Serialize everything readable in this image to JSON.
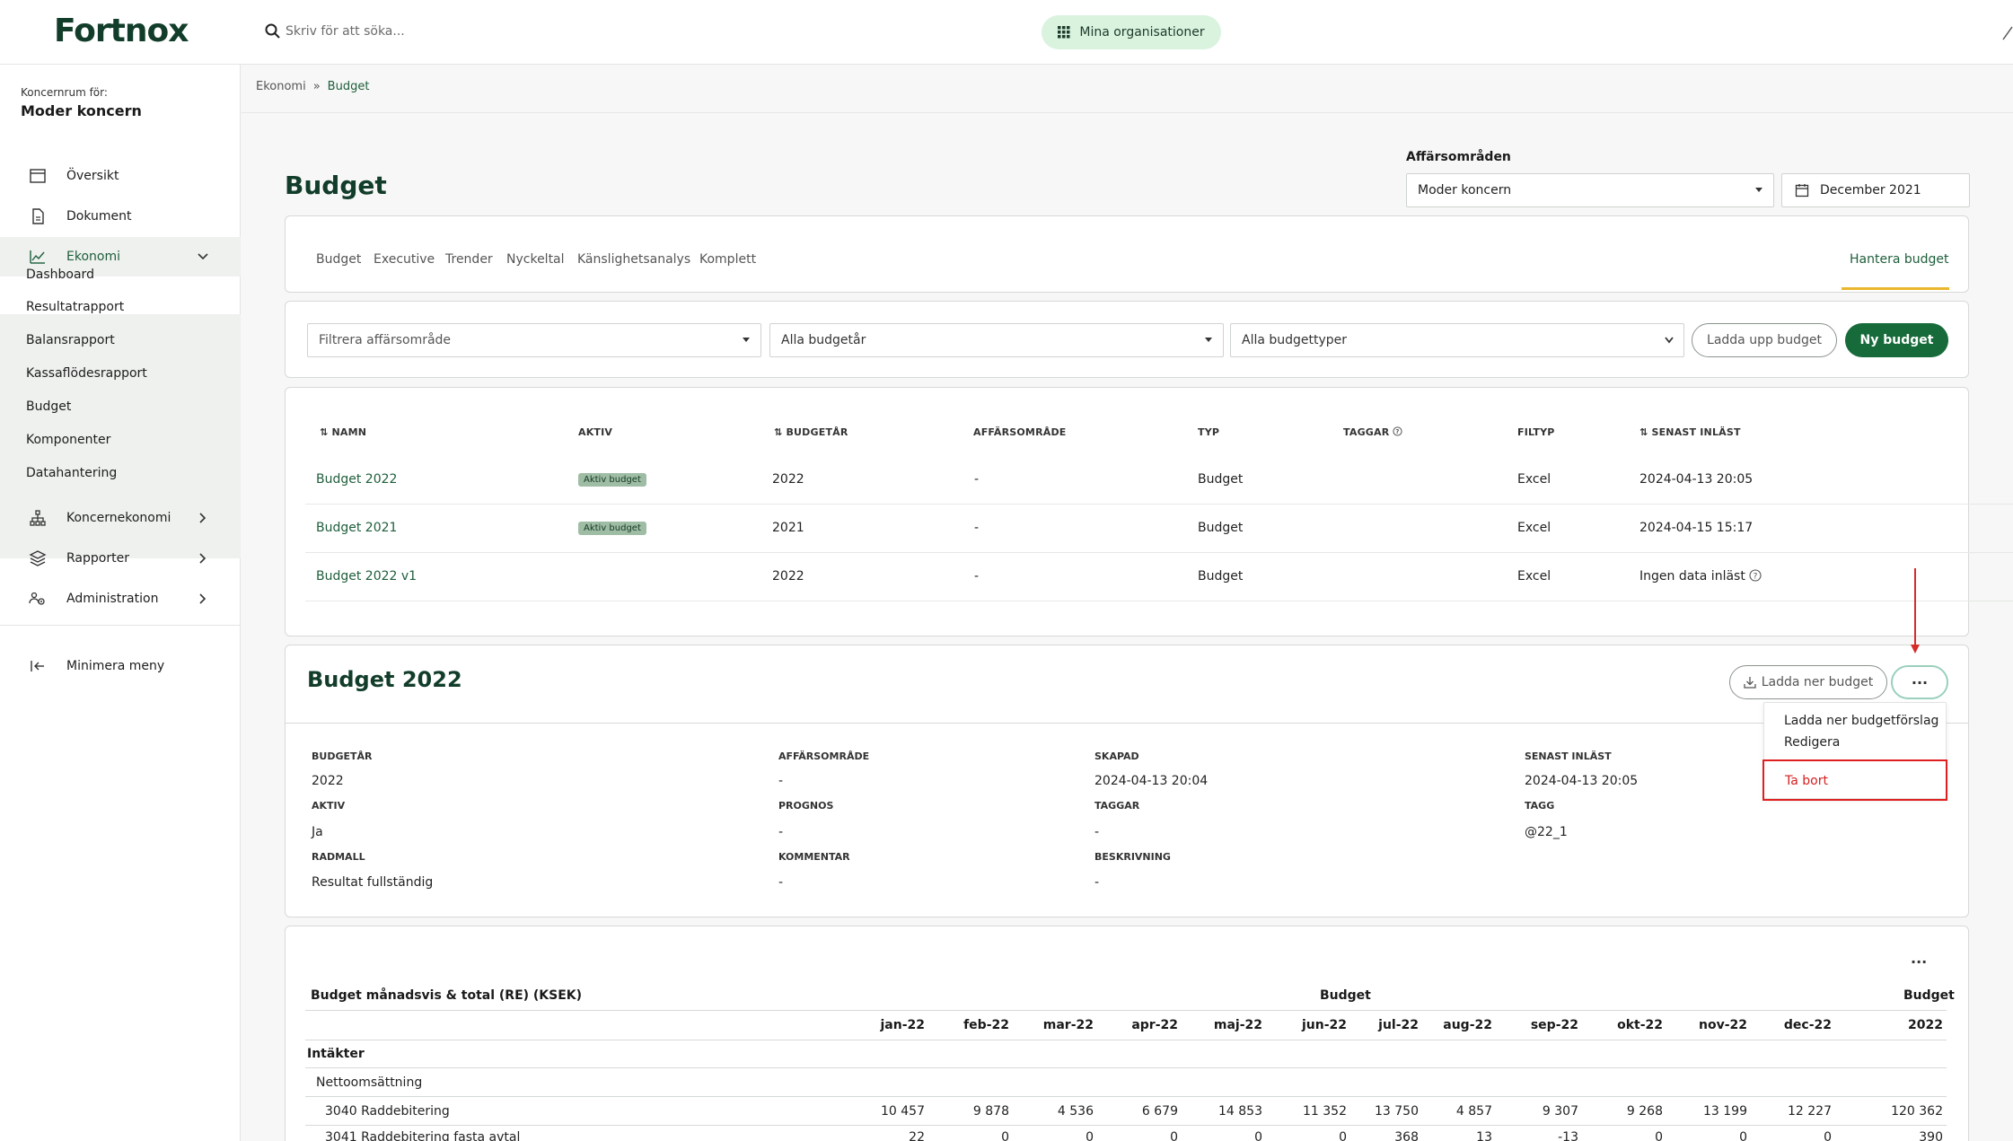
{
  "app": {
    "logo": "Fortnox"
  },
  "topbar": {
    "search_placeholder": "Skriv för att söka...",
    "org_button": "Mina organisationer"
  },
  "sidebar": {
    "org_label": "Koncernrum för:",
    "org_name": "Moder koncern",
    "items": [
      {
        "label": "Översikt",
        "icon": "calendar-icon"
      },
      {
        "label": "Dokument",
        "icon": "document-icon"
      },
      {
        "label": "Ekonomi",
        "icon": "chart-line-icon"
      },
      {
        "label": "Koncernekonomi",
        "icon": "org-tree-icon"
      },
      {
        "label": "Rapporter",
        "icon": "layers-icon"
      },
      {
        "label": "Administration",
        "icon": "users-gear-icon"
      }
    ],
    "sub_items": [
      "Dashboard",
      "Resultatrapport",
      "Balansrapport",
      "Kassaflödesrapport",
      "Budget",
      "Komponenter",
      "Datahantering"
    ],
    "minimize": "Minimera meny"
  },
  "breadcrumb": {
    "parent": "Ekonomi",
    "sep": "»",
    "current": "Budget"
  },
  "page": {
    "title": "Budget",
    "af_label": "Affärsområden",
    "af_value": "Moder koncern",
    "date_value": "December 2021"
  },
  "tabs": [
    "Budget",
    "Executive",
    "Trender",
    "Nyckeltal",
    "Känslighetsanalys",
    "Komplett"
  ],
  "tab_right": "Hantera budget",
  "filters": {
    "area_placeholder": "Filtrera affärsområde",
    "years": "Alla budgetår",
    "types": "Alla budgettyper",
    "upload": "Ladda upp budget",
    "new": "Ny budget"
  },
  "list": {
    "headers": [
      "NAMN",
      "AKTIV",
      "BUDGETÅR",
      "AFFÄRSOMRÅDE",
      "TYP",
      "TAGGAR",
      "FILTYP",
      "SENAST INLÄST"
    ],
    "rows": [
      {
        "name": "Budget 2022",
        "active": "Aktiv budget",
        "year": "2022",
        "area": "-",
        "type": "Budget",
        "filetype": "Excel",
        "loaded": "2024-04-13 20:05"
      },
      {
        "name": "Budget 2021",
        "active": "Aktiv budget",
        "year": "2021",
        "area": "-",
        "type": "Budget",
        "filetype": "Excel",
        "loaded": "2024-04-15 15:17"
      },
      {
        "name": "Budget 2022 v1",
        "active": "",
        "year": "2022",
        "area": "-",
        "type": "Budget",
        "filetype": "Excel",
        "loaded": "Ingen data inläst"
      }
    ]
  },
  "detail": {
    "title": "Budget 2022",
    "download": "Ladda ner budget",
    "more": "···",
    "fields": {
      "budgetar_l": "BUDGETÅR",
      "budgetar_v": "2022",
      "affar_l": "AFFÄRSOMRÅDE",
      "affar_v": "-",
      "skapad_l": "SKAPAD",
      "skapad_v": "2024-04-13 20:04",
      "senast_l": "SENAST INLÄST",
      "senast_v": "2024-04-13 20:05",
      "aktiv_l": "AKTIV",
      "aktiv_v": "Ja",
      "prognos_l": "PROGNOS",
      "prognos_v": "-",
      "taggar_l": "TAGGAR",
      "taggar_v": "-",
      "tagg_l": "TAGG",
      "tagg_v": "@22_1",
      "radmall_l": "RADMALL",
      "radmall_v": "Resultat fullständig",
      "kommentar_l": "KOMMENTAR",
      "kommentar_v": "-",
      "beskrivning_l": "BESKRIVNING",
      "beskrivning_v": "-"
    }
  },
  "menu": {
    "item1": "Ladda ner budgetförslag",
    "item2": "Redigera",
    "delete": "Ta bort"
  },
  "budget_table": {
    "title": "Budget månadsvis & total (RE) (KSEK)",
    "group1": "Budget",
    "group2": "Budget",
    "more": "···",
    "months": [
      "jan-22",
      "feb-22",
      "mar-22",
      "apr-22",
      "maj-22",
      "jun-22",
      "jul-22",
      "aug-22",
      "sep-22",
      "okt-22",
      "nov-22",
      "dec-22",
      "2022"
    ],
    "section": "Intäkter",
    "subsection": "Nettoomsättning",
    "rows": [
      {
        "label": "3040 Raddebitering",
        "values": [
          "10 457",
          "9 878",
          "4 536",
          "6 679",
          "14 853",
          "11 352",
          "13 750",
          "4 857",
          "9 307",
          "9 268",
          "13 199",
          "12 227",
          "120 362"
        ]
      },
      {
        "label": "3041 Raddebitering fasta avtal",
        "values": [
          "22",
          "0",
          "0",
          "0",
          "0",
          "0",
          "368",
          "13",
          "-13",
          "0",
          "0",
          "0",
          "390"
        ]
      }
    ]
  }
}
